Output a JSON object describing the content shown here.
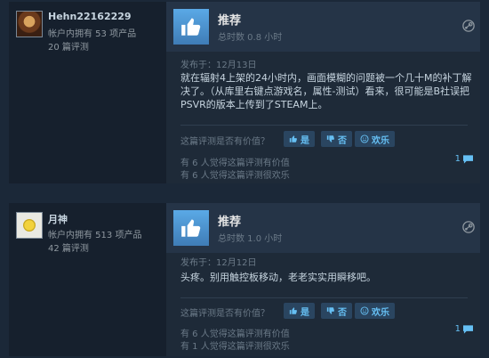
{
  "reviews": [
    {
      "username": "Hehn22162229",
      "products": "帐户内拥有 53 项产品",
      "review_count": "20 篇评测",
      "verdict": "推荐",
      "hours": "总时数 0.8 小时",
      "posted": "发布于：12月13日",
      "text": "就在辐射4上架的24小时内，画面模糊的问题被一个几十M的补丁解决了。（从库里右键点游戏名，属性-测试）看来，很可能是B社误把PSVR的版本上传到了STEAM上。",
      "helpful_question": "这篇评测是否有价值？",
      "yes_label": "是",
      "no_label": "否",
      "funny_label": "欢乐",
      "helpful_stat": "有 6 人觉得这篇评测有价值",
      "funny_stat": "有 6 人觉得这篇评测很欢乐",
      "comment_count": "1"
    },
    {
      "username": "月神",
      "products": "帐户内拥有 513 项产品",
      "review_count": "42 篇评测",
      "verdict": "推荐",
      "hours": "总时数 1.0 小时",
      "posted": "发布于：12月12日",
      "text": "头疼。别用触控板移动，老老实实用瞬移吧。",
      "helpful_question": "这篇评测是否有价值？",
      "yes_label": "是",
      "no_label": "否",
      "funny_label": "欢乐",
      "helpful_stat": "有 6 人觉得这篇评测有价值",
      "funny_stat": "有 1 人觉得这篇评测很欢乐",
      "comment_count": "1"
    }
  ],
  "colors": {
    "background": "#1b2838",
    "accent_blue": "#66c0f4",
    "thumb_blue": "#5aa9e6"
  },
  "icons": [
    "thumbs-up-icon",
    "thumbs-down-icon",
    "smiley-icon",
    "steam-icon",
    "comment-icon"
  ]
}
